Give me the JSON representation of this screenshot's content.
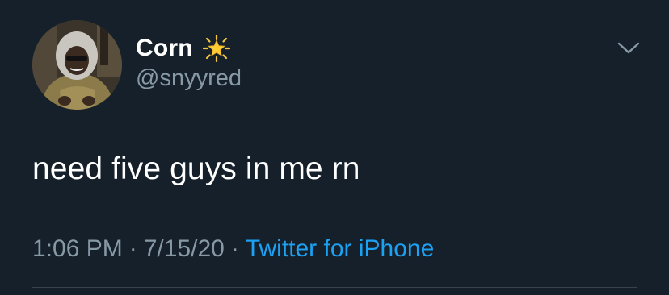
{
  "tweet": {
    "display_name": "Corn",
    "badge_icon": "glowing-star-emoji",
    "handle": "@snyyred",
    "text": "need five guys in me rn",
    "time": "1:06 PM",
    "separator": "·",
    "date": "7/15/20",
    "source": "Twitter for iPhone",
    "menu_icon": "chevron-down-icon"
  },
  "colors": {
    "background": "#15202b",
    "primary_text": "#ffffff",
    "secondary_text": "#8899a6",
    "link": "#1da1f2",
    "divider": "#38444d"
  }
}
